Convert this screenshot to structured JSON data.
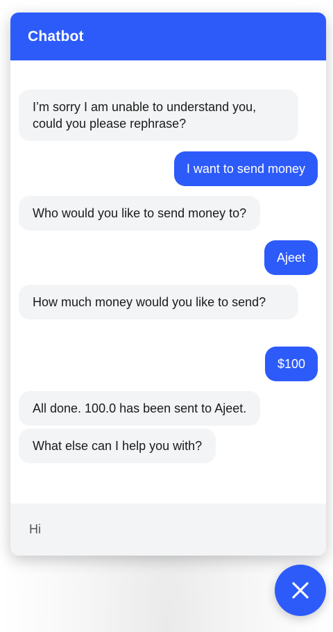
{
  "header": {
    "title": "Chatbot"
  },
  "messages": [
    {
      "from": "bot",
      "text": "I’m sorry I am unable to understand you, could you please rephrase?"
    },
    {
      "from": "user",
      "text": "I want to send money"
    },
    {
      "from": "bot",
      "text": "Who would you like to send money to?"
    },
    {
      "from": "user",
      "text": "Ajeet"
    },
    {
      "from": "bot",
      "text": "How much money would you like to send?"
    },
    {
      "from": "user",
      "text": "$100"
    },
    {
      "from": "bot",
      "text": "All done. 100.0 has been sent to Ajeet."
    },
    {
      "from": "bot",
      "text": "What else can I help you with?"
    }
  ],
  "input": {
    "value": "Hi"
  },
  "colors": {
    "accent": "#2d5bfa",
    "bot_bubble": "#f3f4f6",
    "input_bg": "#f3f4f6"
  },
  "icons": {
    "close": "close-icon"
  }
}
